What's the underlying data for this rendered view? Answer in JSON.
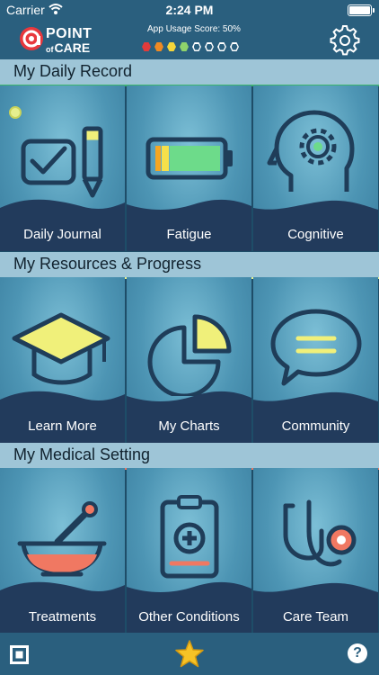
{
  "status_bar": {
    "carrier": "Carrier",
    "time": "2:24 PM"
  },
  "header": {
    "logo_top": "POINT",
    "logo_of": "of",
    "logo_bottom": "CARE",
    "usage_label": "App Usage Score: 50%",
    "usage_fraction": 0.5,
    "usage_dot_colors": [
      "#e23b3b",
      "#f08a23",
      "#f4d53b",
      "#8fd36b",
      "empty",
      "empty",
      "empty",
      "empty"
    ]
  },
  "sections": [
    {
      "title": "My Daily Record",
      "tiles": [
        {
          "label": "Daily Journal",
          "icon": "journal-check-pencil-icon"
        },
        {
          "label": "Fatigue",
          "icon": "battery-icon"
        },
        {
          "label": "Cognitive",
          "icon": "head-gear-icon"
        }
      ]
    },
    {
      "title": "My Resources & Progress",
      "tiles": [
        {
          "label": "Learn More",
          "icon": "graduation-cap-icon"
        },
        {
          "label": "My Charts",
          "icon": "pie-chart-icon"
        },
        {
          "label": "Community",
          "icon": "speech-bubble-icon"
        }
      ]
    },
    {
      "title": "My Medical Setting",
      "tiles": [
        {
          "label": "Treatments",
          "icon": "mortar-pestle-icon"
        },
        {
          "label": "Other Conditions",
          "icon": "clipboard-medical-icon"
        },
        {
          "label": "Care Team",
          "icon": "stethoscope-icon"
        }
      ]
    }
  ],
  "bottom_bar": {
    "left_icon": "square-frame-icon",
    "center_icon": "star-icon",
    "right_icon": "help-icon",
    "right_glyph": "?"
  },
  "colors": {
    "header": "#2a5f7e",
    "section_band": "#9ec5d7",
    "tile_wave": "#223b5c",
    "accent_yellow": "#f0f07a",
    "accent_coral": "#f07862"
  }
}
